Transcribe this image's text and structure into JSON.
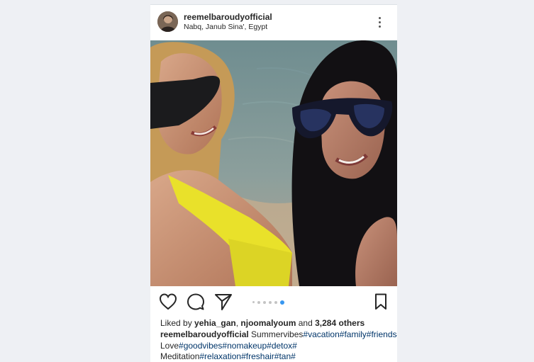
{
  "post": {
    "username": "reemelbaroudyofficial",
    "location": "Nabq, Janub Sina', Egypt",
    "carousel": {
      "count": 6,
      "active_index": 5
    },
    "likes": {
      "prefix": "Liked by ",
      "user1": "yehia_gan",
      "separator": ", ",
      "user2": "njoomalyoum",
      "and": " and ",
      "others": "3,284 others"
    },
    "caption": {
      "author": "reemelbaroudyofficial",
      "line1_text": " Summervibes",
      "line1_tags": [
        "#vacation",
        "#family",
        "#friends",
        "#"
      ],
      "line2_text": "Love",
      "line2_tags": [
        "#goodvibes",
        "#nomakeup",
        "#detox",
        "#"
      ],
      "line3_text": "Meditation",
      "line3_tags": [
        "#relaxation",
        "#freshair",
        "#tan",
        "#"
      ]
    }
  },
  "icons": {
    "more": "more-vertical-icon",
    "like": "heart-icon",
    "comment": "comment-bubble-icon",
    "share": "paper-plane-icon",
    "save": "bookmark-icon"
  },
  "colors": {
    "hashtag": "#003569",
    "active_dot": "#3897f0",
    "inactive_dot": "#c4c4c4",
    "text": "#262626"
  }
}
